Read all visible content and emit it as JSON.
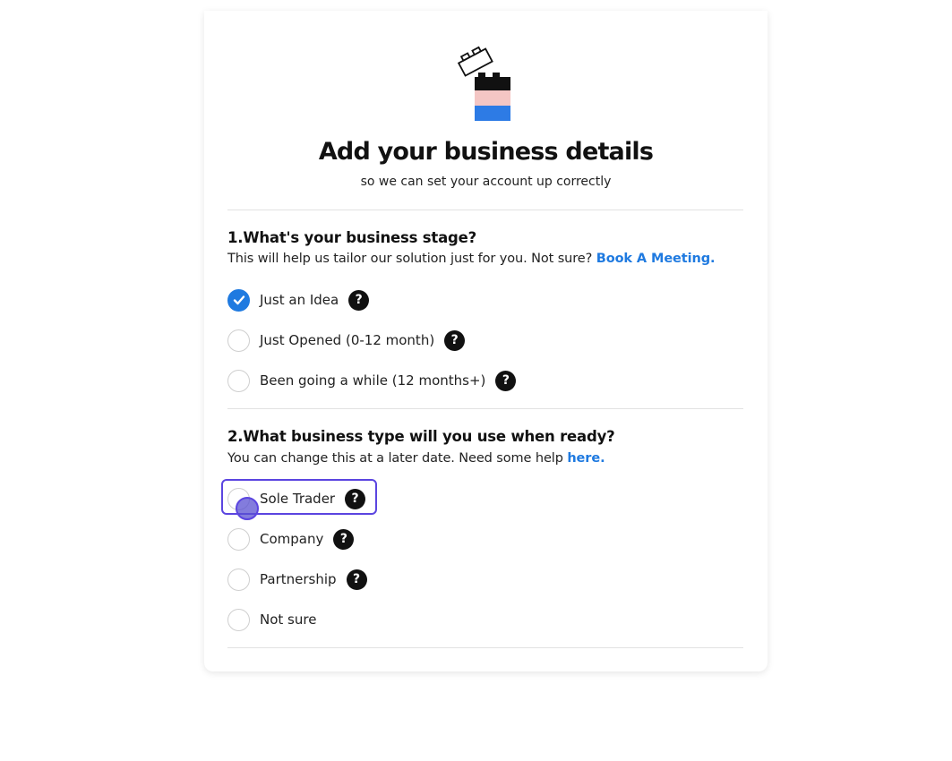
{
  "header": {
    "title": "Add your business details",
    "subtitle": "so we can set your account up correctly"
  },
  "question1": {
    "title": "1.What's your business stage?",
    "help_text": "This will help us tailor our solution just for you. Not sure?",
    "help_link": "Book A Meeting.",
    "options": [
      {
        "label": "Just an Idea",
        "checked": true,
        "has_help": true
      },
      {
        "label": "Just Opened (0-12 month)",
        "checked": false,
        "has_help": true
      },
      {
        "label": "Been going a while (12 months+)",
        "checked": false,
        "has_help": true
      }
    ]
  },
  "question2": {
    "title": "2.What business type will you use when ready?",
    "help_text": "You can change this at a later date. Need some help",
    "help_link": "here.",
    "options": [
      {
        "label": "Sole Trader",
        "checked": false,
        "has_help": true,
        "focused": true
      },
      {
        "label": "Company",
        "checked": false,
        "has_help": true
      },
      {
        "label": "Partnership",
        "checked": false,
        "has_help": true
      },
      {
        "label": "Not sure",
        "checked": false,
        "has_help": false
      }
    ]
  },
  "icons": {
    "help": "?",
    "help_icon_name": "question-circle-icon",
    "check_icon_name": "checkmark-icon",
    "logo_icon_name": "stacked-blocks-logo-icon"
  },
  "colors": {
    "accent": "#1f7ae0",
    "focus": "#5b45e0",
    "logo_black": "#111111",
    "logo_pink": "#f4c6c4",
    "logo_blue": "#2d7be5"
  }
}
